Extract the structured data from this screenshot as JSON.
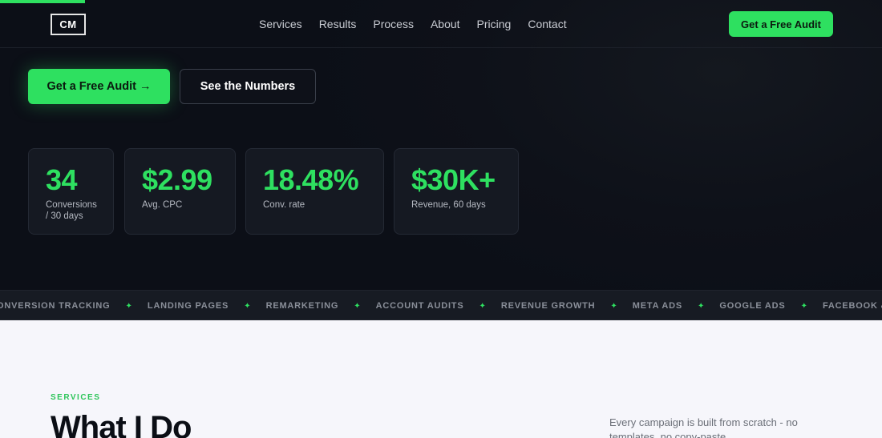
{
  "nav": {
    "logo": "CM",
    "links": [
      "Services",
      "Results",
      "Process",
      "About",
      "Pricing",
      "Contact"
    ],
    "cta": "Get a Free Audit"
  },
  "hero": {
    "primary_cta": "Get a Free Audit →",
    "secondary_cta": "See the Numbers"
  },
  "stats": [
    {
      "value": "34",
      "label": "Conversions / 30 days"
    },
    {
      "value": "$2.99",
      "label": "Avg. CPC"
    },
    {
      "value": "18.48%",
      "label": "Conv. rate"
    },
    {
      "value": "$30K+",
      "label": "Revenue, 60 days"
    }
  ],
  "ticker": [
    "ONVERSION TRACKING",
    "LANDING PAGES",
    "REMARKETING",
    "ACCOUNT AUDITS",
    "REVENUE GROWTH",
    "META ADS",
    "GOOGLE ADS",
    "FACEBOOK & INSTAGR"
  ],
  "ticker_separator": "✦",
  "services": {
    "eyebrow": "SERVICES",
    "title": "What I Do",
    "description": "Every campaign is built from scratch - no templates, no copy-paste."
  },
  "colors": {
    "accent": "#2ee060",
    "dark_bg": "#0c0f17",
    "light_bg": "#f6f6fb"
  }
}
